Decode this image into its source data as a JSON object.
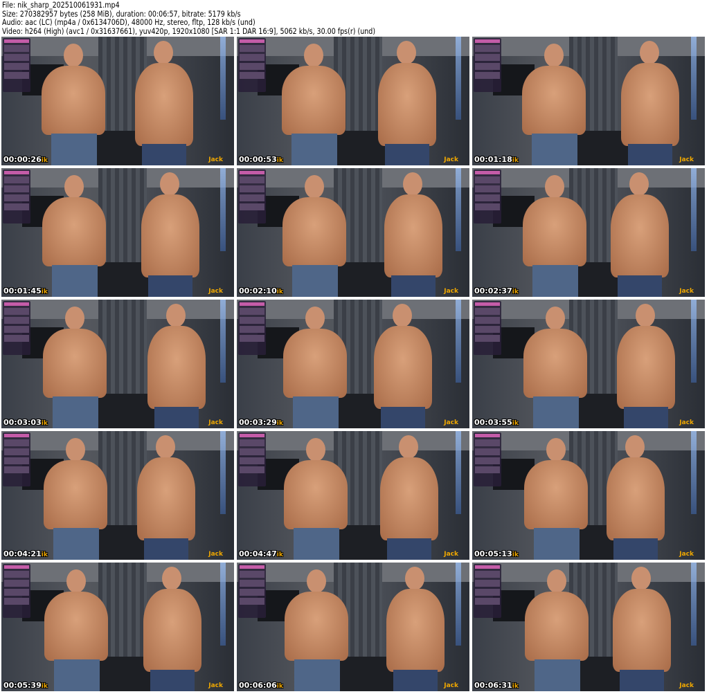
{
  "header": {
    "file": "File: nik_sharp_202510061931.mp4",
    "size": "Size: 270382957 bytes (258 MiB), duration: 00:06:57, bitrate: 5179 kb/s",
    "audio": "Audio: aac (LC) (mp4a / 0x6134706D), 48000 Hz, stereo, fltp, 128 kb/s (und)",
    "video": "Video: h264 (High) (avc1 / 0x31637661), yuv420p, 1920x1080 [SAR 1:1 DAR 16:9], 5062 kb/s, 30.00 fps(r) (und)"
  },
  "thumbnails": [
    {
      "timestamp": "00:00:26",
      "left_label": "ik",
      "right_label": "Jack"
    },
    {
      "timestamp": "00:00:53",
      "left_label": "ik",
      "right_label": "Jack"
    },
    {
      "timestamp": "00:01:18",
      "left_label": "ik",
      "right_label": "Jack"
    },
    {
      "timestamp": "00:01:45",
      "left_label": "ik",
      "right_label": "Jack"
    },
    {
      "timestamp": "00:02:10",
      "left_label": "ik",
      "right_label": "Jack"
    },
    {
      "timestamp": "00:02:37",
      "left_label": "ik",
      "right_label": "Jack"
    },
    {
      "timestamp": "00:03:03",
      "left_label": "ik",
      "right_label": "Jack"
    },
    {
      "timestamp": "00:03:29",
      "left_label": "ik",
      "right_label": "Jack"
    },
    {
      "timestamp": "00:03:55",
      "left_label": "ik",
      "right_label": "Jack"
    },
    {
      "timestamp": "00:04:21",
      "left_label": "ik",
      "right_label": "Jack"
    },
    {
      "timestamp": "00:04:47",
      "left_label": "ik",
      "right_label": "Jack"
    },
    {
      "timestamp": "00:05:13",
      "left_label": "ik",
      "right_label": "Jack"
    },
    {
      "timestamp": "00:05:39",
      "left_label": "ik",
      "right_label": "Jack"
    },
    {
      "timestamp": "00:06:06",
      "left_label": "ik",
      "right_label": "Jack"
    },
    {
      "timestamp": "00:06:31",
      "left_label": "ik",
      "right_label": "Jack"
    }
  ]
}
